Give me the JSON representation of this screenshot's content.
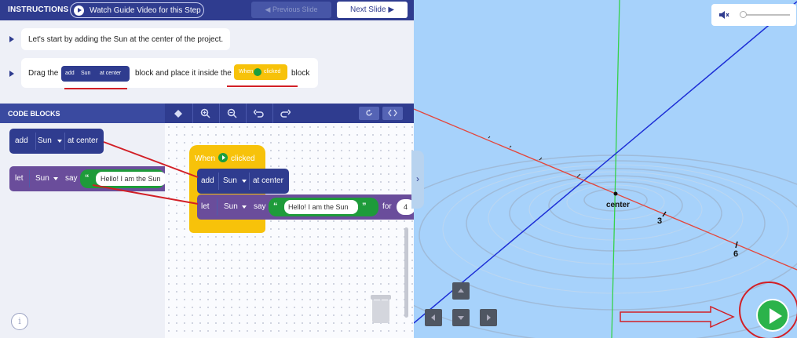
{
  "instructions_bar": {
    "title": "INSTRUCTIONS",
    "watch_label": "Watch Guide Video for this Step",
    "prev_label": "◀  Previous Slide",
    "next_label": "Next Slide  ▶"
  },
  "instructions": {
    "step1": "Let's start by adding the Sun at the center of the project.",
    "step2_prefix": "Drag the",
    "step2_middle": "block and place it inside the",
    "step2_suffix": "block",
    "mini_add": {
      "word": "add",
      "target": "Sun",
      "position": "at center"
    },
    "mini_when": {
      "word": "When",
      "event": "clicked"
    }
  },
  "code_blocks": {
    "title": "CODE BLOCKS",
    "add_block": {
      "word": "add",
      "target": "Sun",
      "position": "at center"
    },
    "let_block": {
      "word": "let",
      "target": "Sun",
      "verb": "say",
      "quote_open": "“",
      "message": "Hello! I am the Sun"
    }
  },
  "workspace": {
    "when_block": {
      "word": "When",
      "event": "clicked"
    },
    "add_block": {
      "word": "add",
      "target": "Sun",
      "position": "at center"
    },
    "let_block": {
      "word": "let",
      "target": "Sun",
      "verb": "say",
      "quote_open": "“",
      "message": "Hello! I am the Sun",
      "quote_close": "”",
      "for_word": "for",
      "seconds": "4"
    }
  },
  "toolbar": {
    "icons": [
      "target-icon",
      "zoom-in-icon",
      "zoom-out-icon",
      "undo-icon",
      "redo-icon",
      "reset-icon",
      "code-view-icon"
    ]
  },
  "stage": {
    "center_label": "center",
    "tick_3": "3",
    "tick_6": "6"
  },
  "colors": {
    "header_navy": "#2f3c8f",
    "add_block": "#2f3c8f",
    "let_block": "#6a4d9b",
    "say_green": "#1e9b3a",
    "hat_yellow": "#f7c20a",
    "stage_sky": "#a7d2fb",
    "play_green": "#2bb34a",
    "annotation_red": "#d21f26"
  }
}
